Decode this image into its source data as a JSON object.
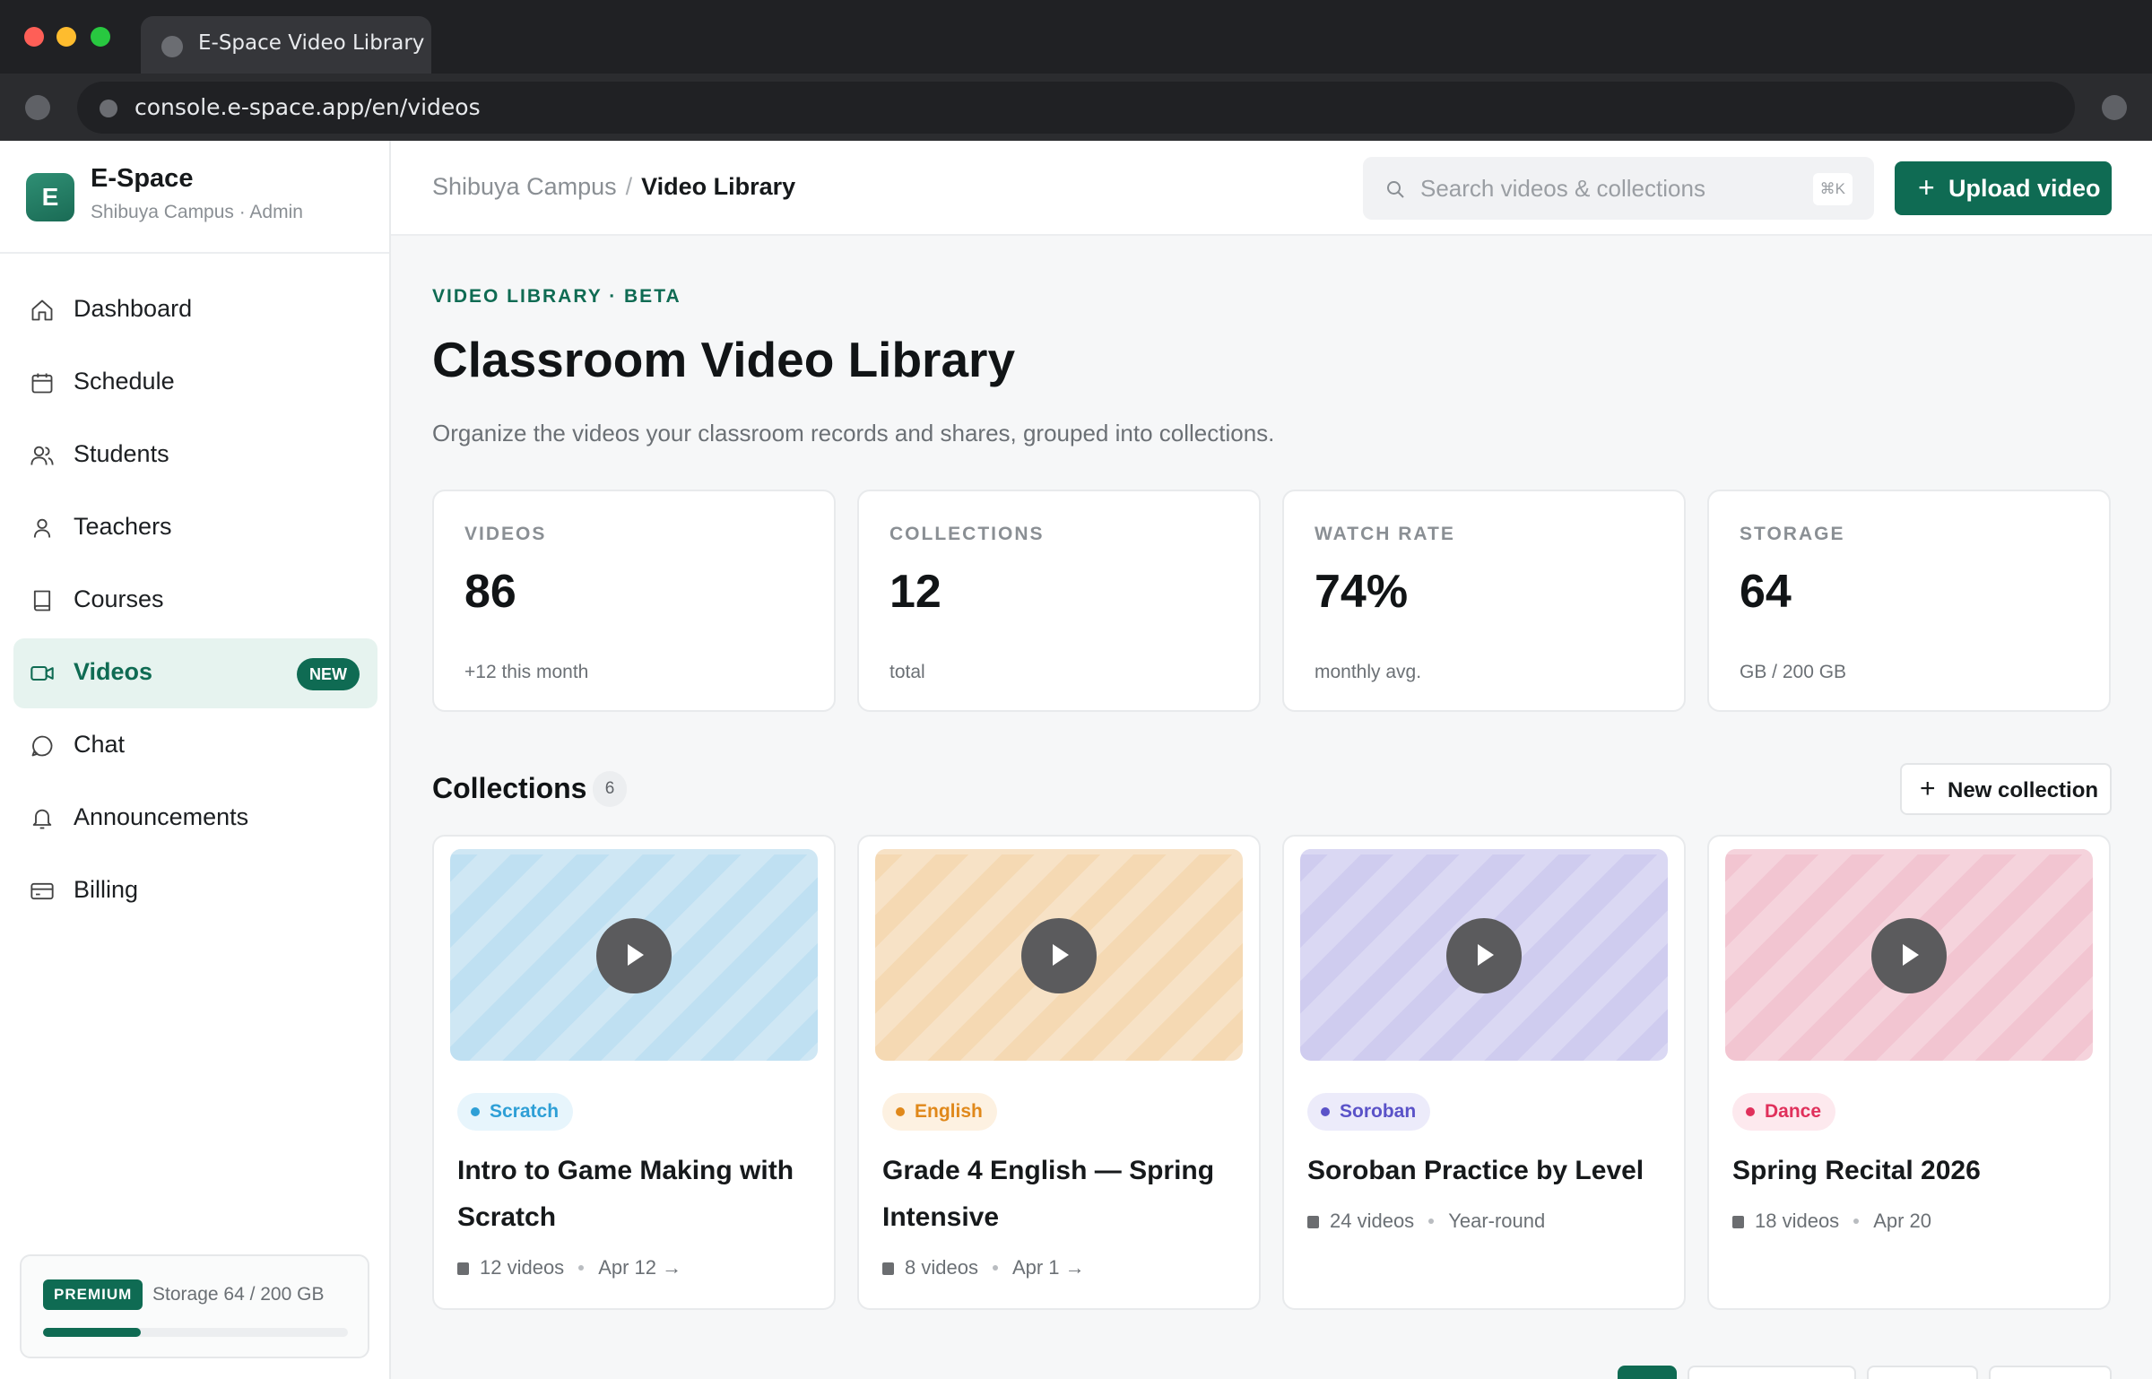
{
  "browser": {
    "tab_title": "E-Space Video Library",
    "url": "console.e-space.app/en/videos"
  },
  "brand": {
    "logo_letter": "E",
    "name": "E-Space",
    "subtitle": "Shibuya Campus · Admin"
  },
  "sidebar": {
    "items": [
      {
        "label": "Dashboard",
        "icon": "home-icon"
      },
      {
        "label": "Schedule",
        "icon": "calendar-icon"
      },
      {
        "label": "Students",
        "icon": "users-icon"
      },
      {
        "label": "Teachers",
        "icon": "user-icon"
      },
      {
        "label": "Courses",
        "icon": "book-icon"
      },
      {
        "label": "Videos",
        "icon": "video-icon",
        "active": true,
        "badge": "NEW"
      },
      {
        "label": "Chat",
        "icon": "chat-icon"
      },
      {
        "label": "Announcements",
        "icon": "bell-icon"
      },
      {
        "label": "Billing",
        "icon": "credit-card-icon"
      }
    ],
    "plan": {
      "badge": "PREMIUM",
      "storage_text": "Storage 64 / 200 GB",
      "storage_fraction": 0.32
    }
  },
  "header": {
    "breadcrumb_parent": "Shibuya Campus",
    "breadcrumb_sep": "/",
    "breadcrumb_current": "Video Library",
    "search_placeholder": "Search videos & collections",
    "search_shortcut": "⌘K",
    "upload_label": "Upload video"
  },
  "page": {
    "eyebrow": "VIDEO LIBRARY · BETA",
    "title": "Classroom Video Library",
    "description": "Organize the videos your classroom records and shares, grouped into collections."
  },
  "stats": [
    {
      "label": "VIDEOS",
      "value": "86",
      "note": "+12 this month"
    },
    {
      "label": "COLLECTIONS",
      "value": "12",
      "note": "total"
    },
    {
      "label": "WATCH RATE",
      "value": "74%",
      "note": "monthly avg."
    },
    {
      "label": "STORAGE",
      "value": "64",
      "note": "GB / 200 GB"
    }
  ],
  "collections": {
    "title": "Collections",
    "count": "6",
    "new_label": "New collection",
    "items": [
      {
        "tag": "Scratch",
        "title": "Intro to Game Making with Scratch",
        "videos": "12 videos",
        "date": "Apr 12 →",
        "theme": "#bfe0f2",
        "stripe": "#cfe7f4",
        "tag_bg": "#e7f5fc",
        "tag_color": "#2e9fd6"
      },
      {
        "tag": "English",
        "title": "Grade 4 English — Spring Intensive",
        "videos": "8 videos",
        "date": "Apr 1 →",
        "theme": "#f5d9b3",
        "stripe": "#f7e2c6",
        "tag_bg": "#fdf1e1",
        "tag_color": "#e0881a"
      },
      {
        "tag": "Soroban",
        "title": "Soroban Practice by Level",
        "videos": "24 videos",
        "date": "Year-round",
        "theme": "#cfccef",
        "stripe": "#dad8f3",
        "tag_bg": "#ecebfa",
        "tag_color": "#5a52c8"
      },
      {
        "tag": "Dance",
        "title": "Spring Recital 2026",
        "videos": "18 videos",
        "date": "Apr 20",
        "theme": "#f2c5d1",
        "stripe": "#f5d3dc",
        "tag_bg": "#fde9ee",
        "tag_color": "#e0305b"
      }
    ]
  },
  "colors": {
    "accent": "#0f6b53",
    "accent_soft": "#e6f3ef"
  }
}
